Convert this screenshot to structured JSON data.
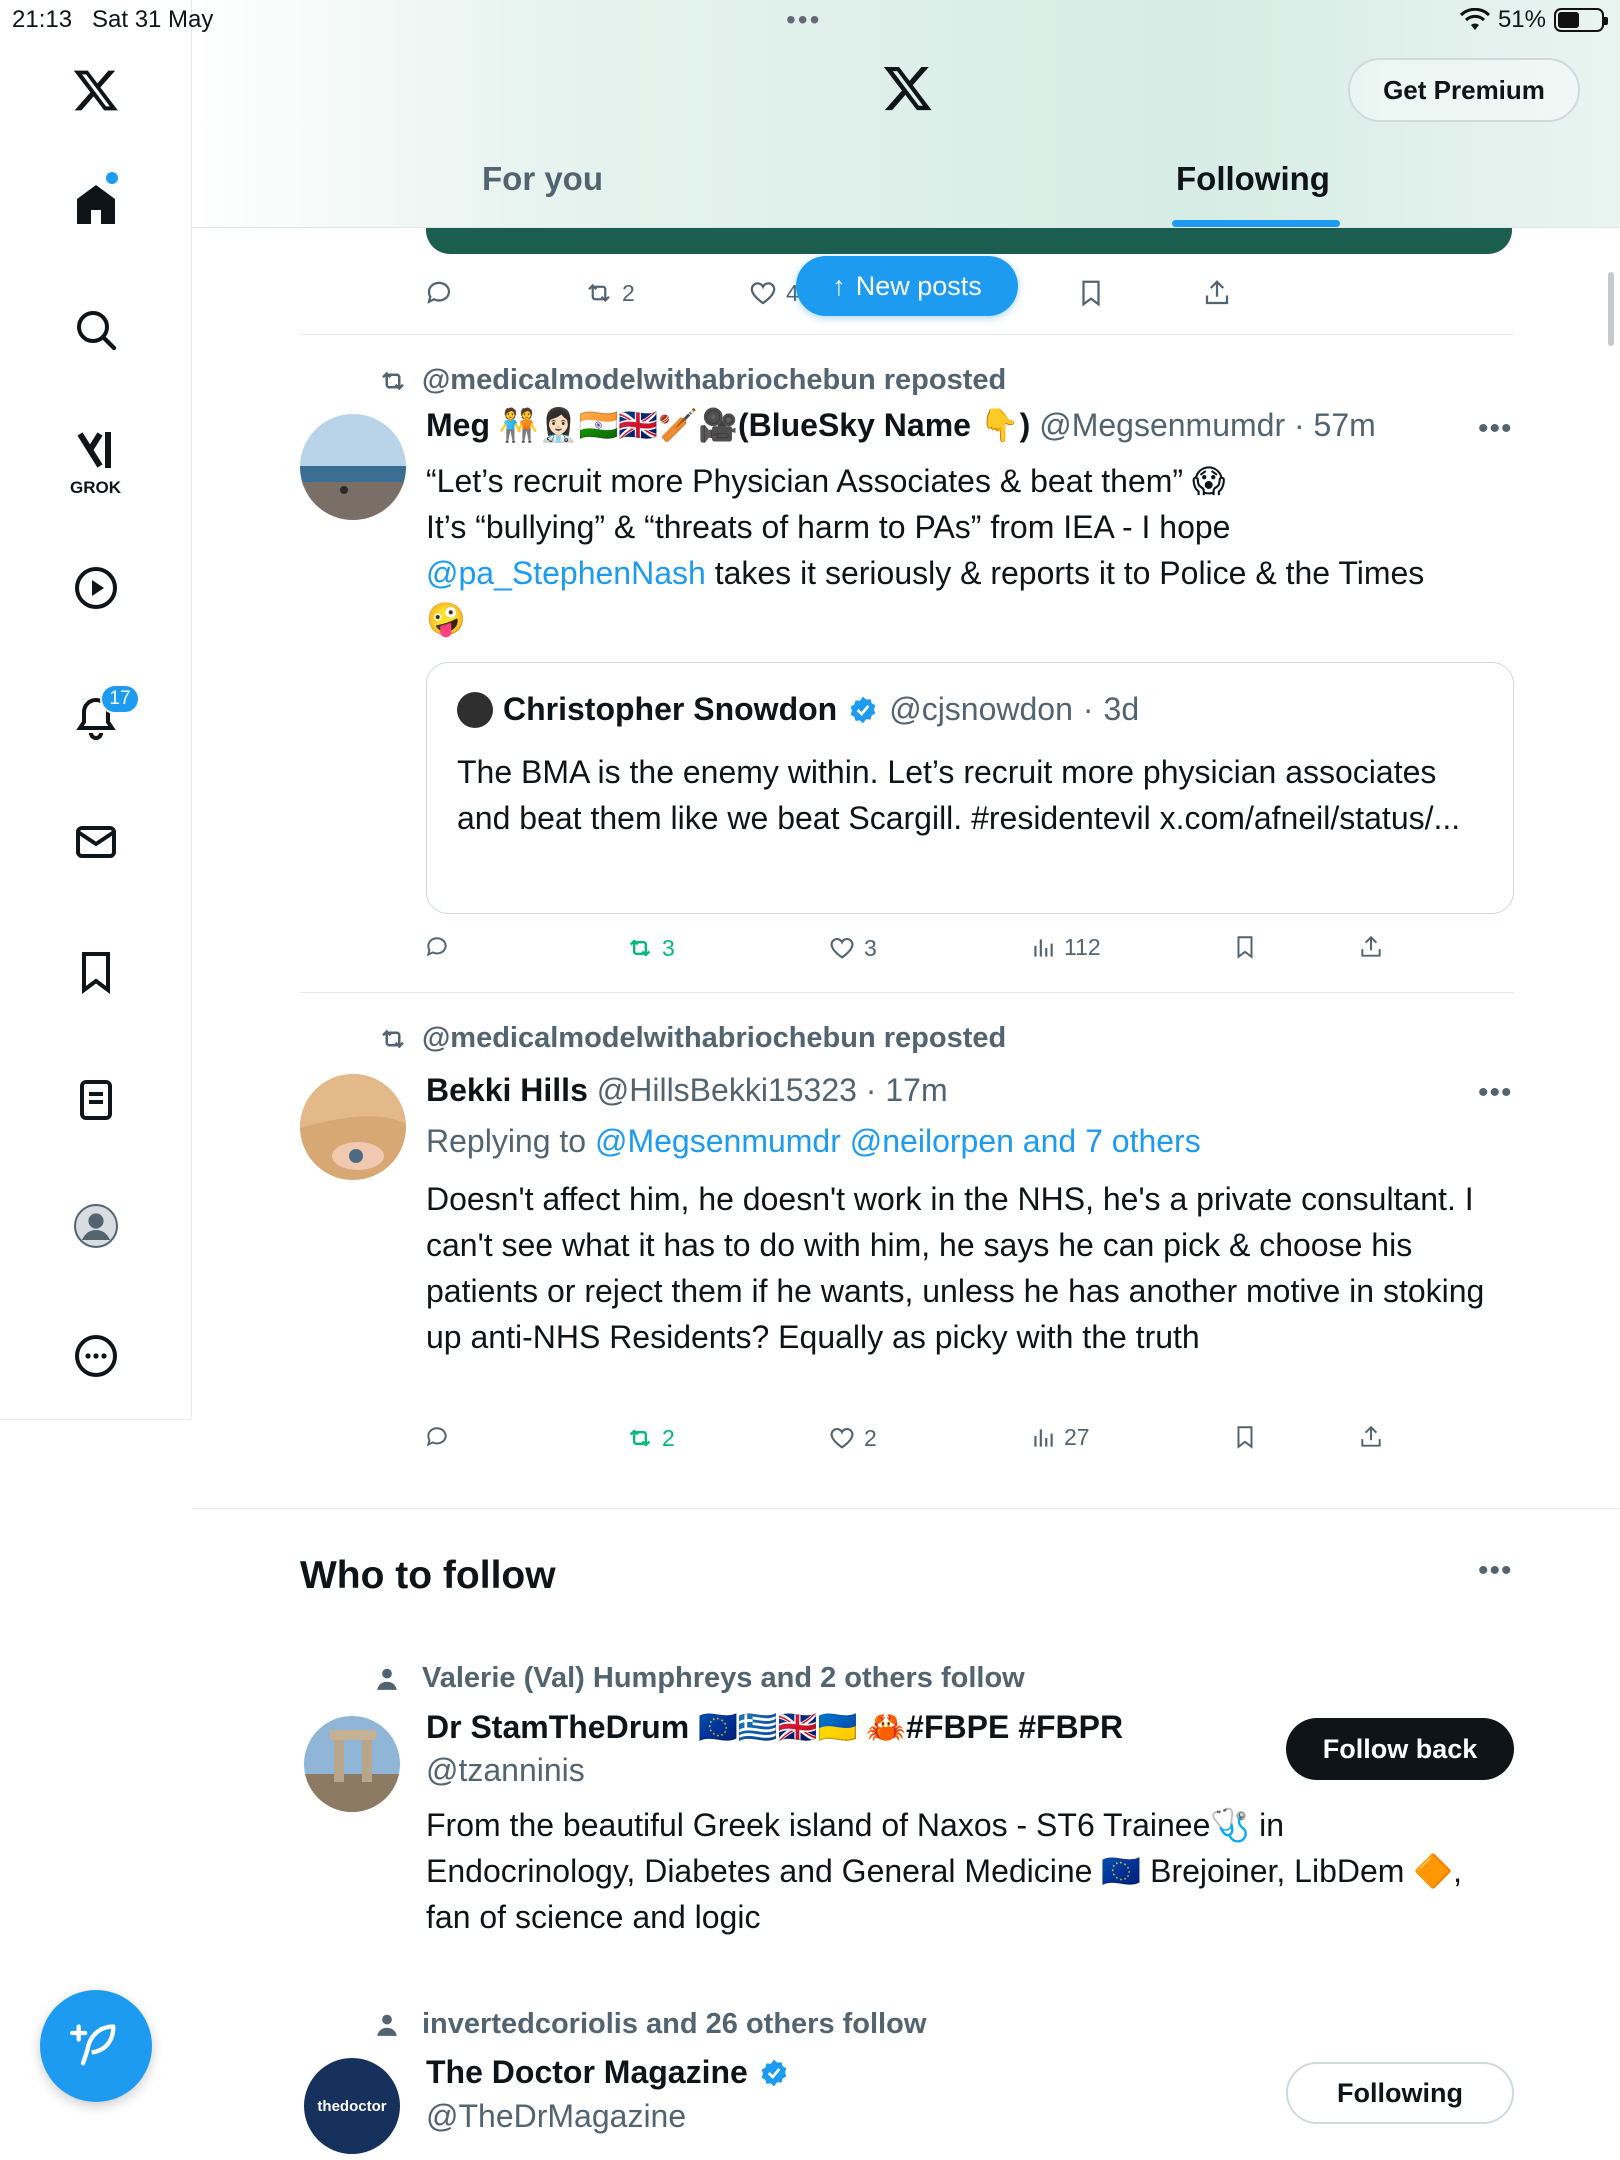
{
  "status_bar": {
    "time": "21:13",
    "date": "Sat 31 May",
    "battery": "51%",
    "battery_level": 0.51
  },
  "header": {
    "premium_label": "Get Premium",
    "tabs": [
      {
        "label": "For you"
      },
      {
        "label": "Following"
      }
    ],
    "selected_tab": "Following"
  },
  "sidebar": {
    "grok_label": "GROK",
    "notifications_count": "17"
  },
  "new_posts_label": "New posts",
  "top_actions": {
    "reposts": "2",
    "likes": "4"
  },
  "posts": [
    {
      "repost_by": "@medicalmodelwithabriochebun reposted",
      "name": "Meg 🧑‍🤝‍🧑👩🏻‍⚕️🇮🇳🇬🇧🏏🎥(BlueSky Name 👇)",
      "handle": "@Megsenmumdr",
      "time": "57m",
      "text_line1": "“Let’s recruit more Physician Associates & beat them” 😱",
      "text_line2": "It’s “bullying” & “threats of harm to PAs” from IEA - I hope",
      "mention": "@pa_StephenNash",
      "text_line3_rest": " takes it seriously & reports it to Police & the Times",
      "text_emoji": "🤪",
      "quote": {
        "name": "Christopher Snowdon",
        "handle": "@cjsnowdon",
        "time": "3d",
        "text": "The BMA is the enemy within. Let’s recruit more physician associates and beat them like we beat Scargill. #residentevil x.com/afneil/status/..."
      },
      "reposts": "3",
      "likes": "3",
      "views": "112"
    },
    {
      "repost_by": "@medicalmodelwithabriochebun reposted",
      "name": "Bekki Hills",
      "handle": "@HillsBekki15323",
      "time": "17m",
      "replying_prefix": "Replying to ",
      "replying_to": "@Megsenmumdr @neilorpen and 7 others",
      "text": "Doesn't affect him, he doesn't work in the NHS, he's a private consultant. I can't see what it has to do with him, he says he can pick & choose his patients or reject them if he wants, unless he has another motive in stoking up anti-NHS Residents? Equally as picky with the truth",
      "reposts": "2",
      "likes": "2",
      "views": "27"
    }
  ],
  "who_to_follow": {
    "title": "Who to follow",
    "accounts": [
      {
        "social_context": "Valerie (Val) Humphreys and 2 others follow",
        "name": "Dr StamTheDrum 🇪🇺🇬🇷🇬🇧🇺🇦 🦀#FBPE #FBPR",
        "handle": "@tzanninis",
        "bio": "From the beautiful Greek island of Naxos - ST6 Trainee🩺 in Endocrinology, Diabetes and General Medicine 🇪🇺 Brejoiner, LibDem 🔶, fan of science and logic",
        "button": "Follow back"
      },
      {
        "social_context": "invertedcoriolis and 26 others follow",
        "name": "The Doctor Magazine",
        "handle": "@TheDrMagazine",
        "avatar_text": "thedoctor",
        "button": "Following"
      }
    ]
  },
  "colors": {
    "accent": "#1d9bf0",
    "repost_green": "#00ba7c",
    "text_secondary": "#536471"
  }
}
